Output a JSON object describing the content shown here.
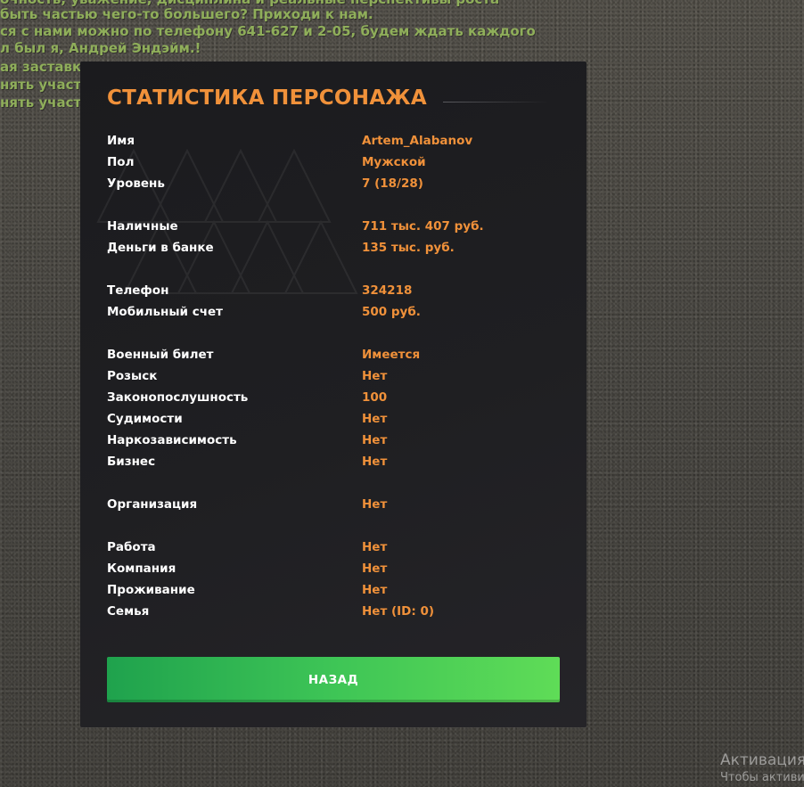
{
  "chat": [
    "очность, уважение, дисциплина и реальные перспективы роста",
    "быть частью чего-то большего? Приходи к нам.",
    "ся с нами можно по телефону 641-627 и 2-05, будем ждать каждого",
    "л был я, Андрей Эндэйм.!",
    "ая заставка",
    "нять участ",
    "нять участ"
  ],
  "dialog": {
    "title": "СТАТИСТИКА ПЕРСОНАЖА",
    "stats": [
      {
        "label": "Имя",
        "value": "Artem_Alabanov"
      },
      {
        "label": "Пол",
        "value": "Мужской"
      },
      {
        "label": "Уровень",
        "value": "7 (18/28)"
      },
      {
        "label": "Наличные",
        "value": "711 тыс. 407 руб."
      },
      {
        "label": "Деньги в банке",
        "value": "135 тыс. руб."
      },
      {
        "label": "Телефон",
        "value": "324218"
      },
      {
        "label": "Мобильный счет",
        "value": "500 руб."
      },
      {
        "label": "Военный билет",
        "value": "Имеется"
      },
      {
        "label": "Розыск",
        "value": "Нет"
      },
      {
        "label": "Законопослушность",
        "value": "100"
      },
      {
        "label": "Судимости",
        "value": "Нет"
      },
      {
        "label": "Наркозависимость",
        "value": "Нет"
      },
      {
        "label": "Бизнес",
        "value": "Нет"
      },
      {
        "label": "Организация",
        "value": "Нет"
      },
      {
        "label": "Работа",
        "value": "Нет"
      },
      {
        "label": "Компания",
        "value": "Нет"
      },
      {
        "label": "Проживание",
        "value": "Нет"
      },
      {
        "label": "Семья",
        "value": "Нет (ID: 0)"
      }
    ],
    "back_label": "НАЗАД"
  },
  "watermark": {
    "title": "Активация",
    "subtitle": "Чтобы активи"
  },
  "colors": {
    "accent": "#f0913a",
    "button": "#3ec556",
    "panel": "#1e1e21",
    "chat": "#8fae5a"
  }
}
